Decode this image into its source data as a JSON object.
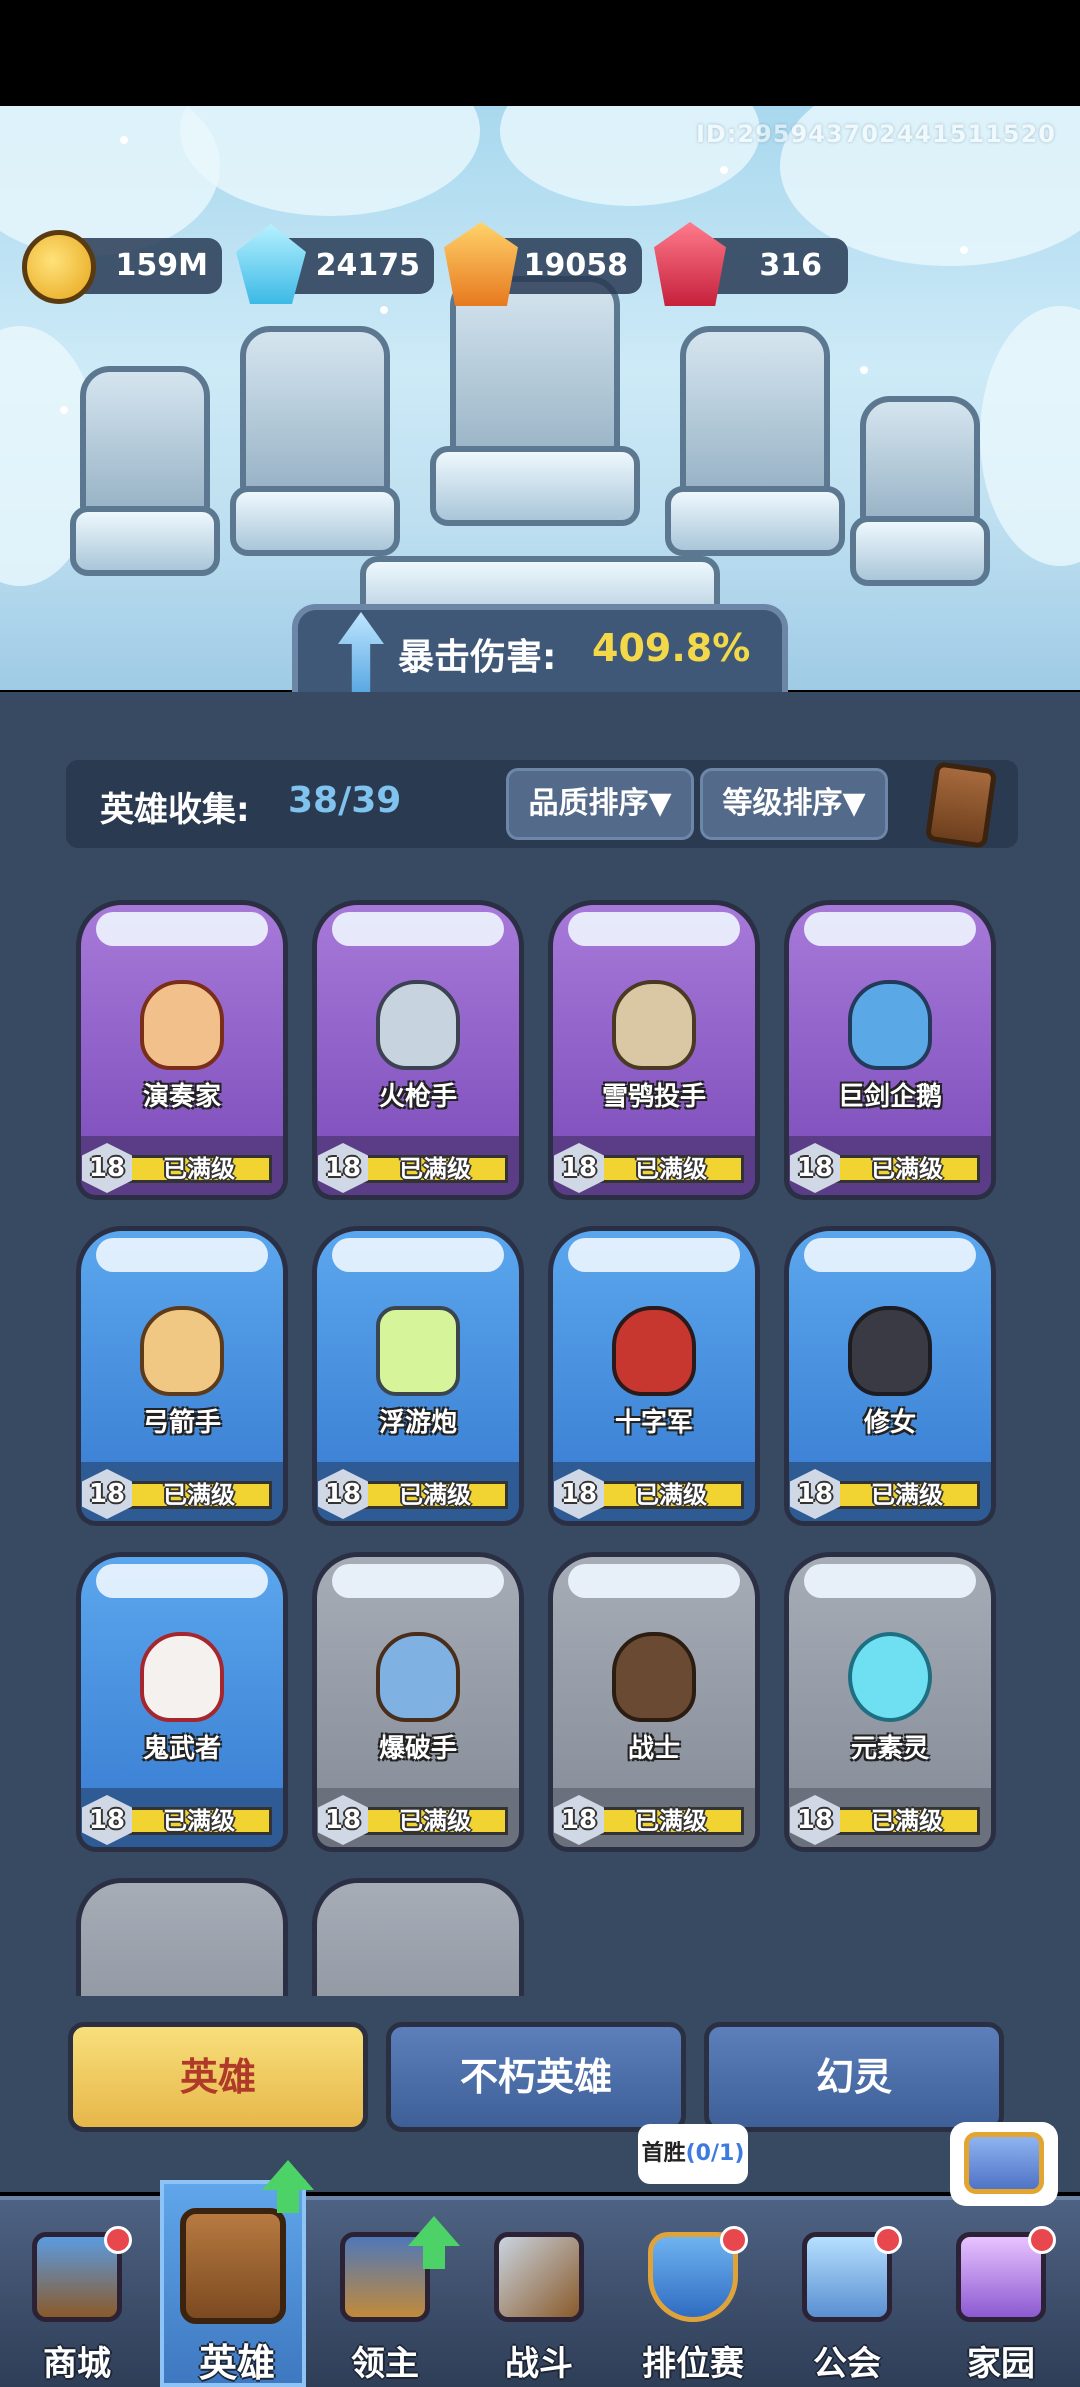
{
  "player_id": "ID:295943702441511520",
  "currencies": [
    {
      "name": "gold",
      "icon": "gold-coin-icon",
      "value": "159M",
      "color": "#f4c23a"
    },
    {
      "name": "crystal",
      "icon": "blue-crystal-icon",
      "value": "24175",
      "color": "#6fd7f2"
    },
    {
      "name": "amber",
      "icon": "orange-gem-icon",
      "value": "19058",
      "color": "#f29a2e"
    },
    {
      "name": "ruby",
      "icon": "red-gem-icon",
      "value": "316",
      "color": "#e4344a"
    }
  ],
  "crit": {
    "label": "暴击伤害:",
    "value": "409.8%"
  },
  "collection": {
    "label": "英雄收集:",
    "count": "38/39",
    "sort_quality": "品质排序▼",
    "sort_level": "等级排序▼"
  },
  "heroes": [
    {
      "name": "演奏家",
      "level": "18",
      "status": "已满级",
      "rarity": "epic"
    },
    {
      "name": "火枪手",
      "level": "18",
      "status": "已满级",
      "rarity": "epic"
    },
    {
      "name": "雪鸮投手",
      "level": "18",
      "status": "已满级",
      "rarity": "epic"
    },
    {
      "name": "巨剑企鹅",
      "level": "18",
      "status": "已满级",
      "rarity": "epic"
    },
    {
      "name": "弓箭手",
      "level": "18",
      "status": "已满级",
      "rarity": "rare"
    },
    {
      "name": "浮游炮",
      "level": "18",
      "status": "已满级",
      "rarity": "rare"
    },
    {
      "name": "十字军",
      "level": "18",
      "status": "已满级",
      "rarity": "rare"
    },
    {
      "name": "修女",
      "level": "18",
      "status": "已满级",
      "rarity": "rare"
    },
    {
      "name": "鬼武者",
      "level": "18",
      "status": "已满级",
      "rarity": "rare"
    },
    {
      "name": "爆破手",
      "level": "18",
      "status": "已满级",
      "rarity": "common"
    },
    {
      "name": "战士",
      "level": "18",
      "status": "已满级",
      "rarity": "common"
    },
    {
      "name": "元素灵",
      "level": "18",
      "status": "已满级",
      "rarity": "common"
    }
  ],
  "category_tabs": [
    {
      "label": "英雄",
      "active": true
    },
    {
      "label": "不朽英雄",
      "active": false
    },
    {
      "label": "幻灵",
      "active": false
    }
  ],
  "nav": [
    {
      "label": "商城",
      "icon": "shop-chest-icon"
    },
    {
      "label": "英雄",
      "icon": "hero-card-icon",
      "active": true
    },
    {
      "label": "领主",
      "icon": "lord-banner-icon"
    },
    {
      "label": "战斗",
      "icon": "crossed-swords-icon"
    },
    {
      "label": "排位赛",
      "icon": "ranked-shield-icon"
    },
    {
      "label": "公会",
      "icon": "guild-castle-icon"
    },
    {
      "label": "家园",
      "icon": "home-castle-icon"
    }
  ],
  "first_win": {
    "label": "首胜",
    "count": "(0/1)"
  },
  "colors": {
    "epic": "#8f5fcb",
    "rare": "#4a90e2",
    "common": "#9aa1ab",
    "max_bar": "#f1d332",
    "crit_value": "#f3d94a",
    "accent_tab": "#f1c95a"
  }
}
